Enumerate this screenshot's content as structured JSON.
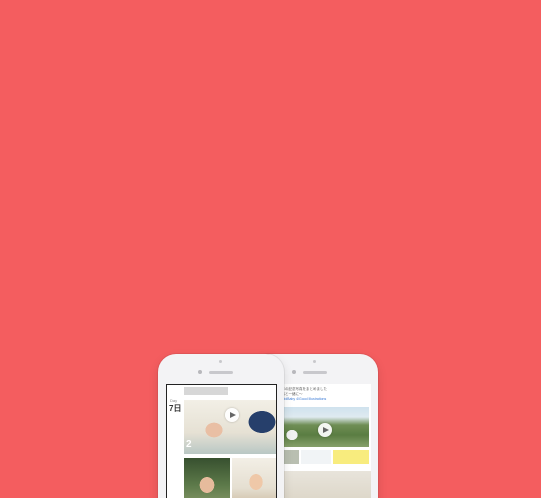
{
  "background_color": "#f45d5f",
  "left_phone": {
    "date_label": "Day",
    "date_day": "7日",
    "overlay_number": "2"
  },
  "right_phone": {
    "date": "日",
    "text_line1": "今年の記念写真をまとめました",
    "text_line2": "家族と一緒に〜",
    "link_text": "CupidBaby 4/Good Illustrations"
  },
  "icons": {
    "play": "play-icon"
  }
}
